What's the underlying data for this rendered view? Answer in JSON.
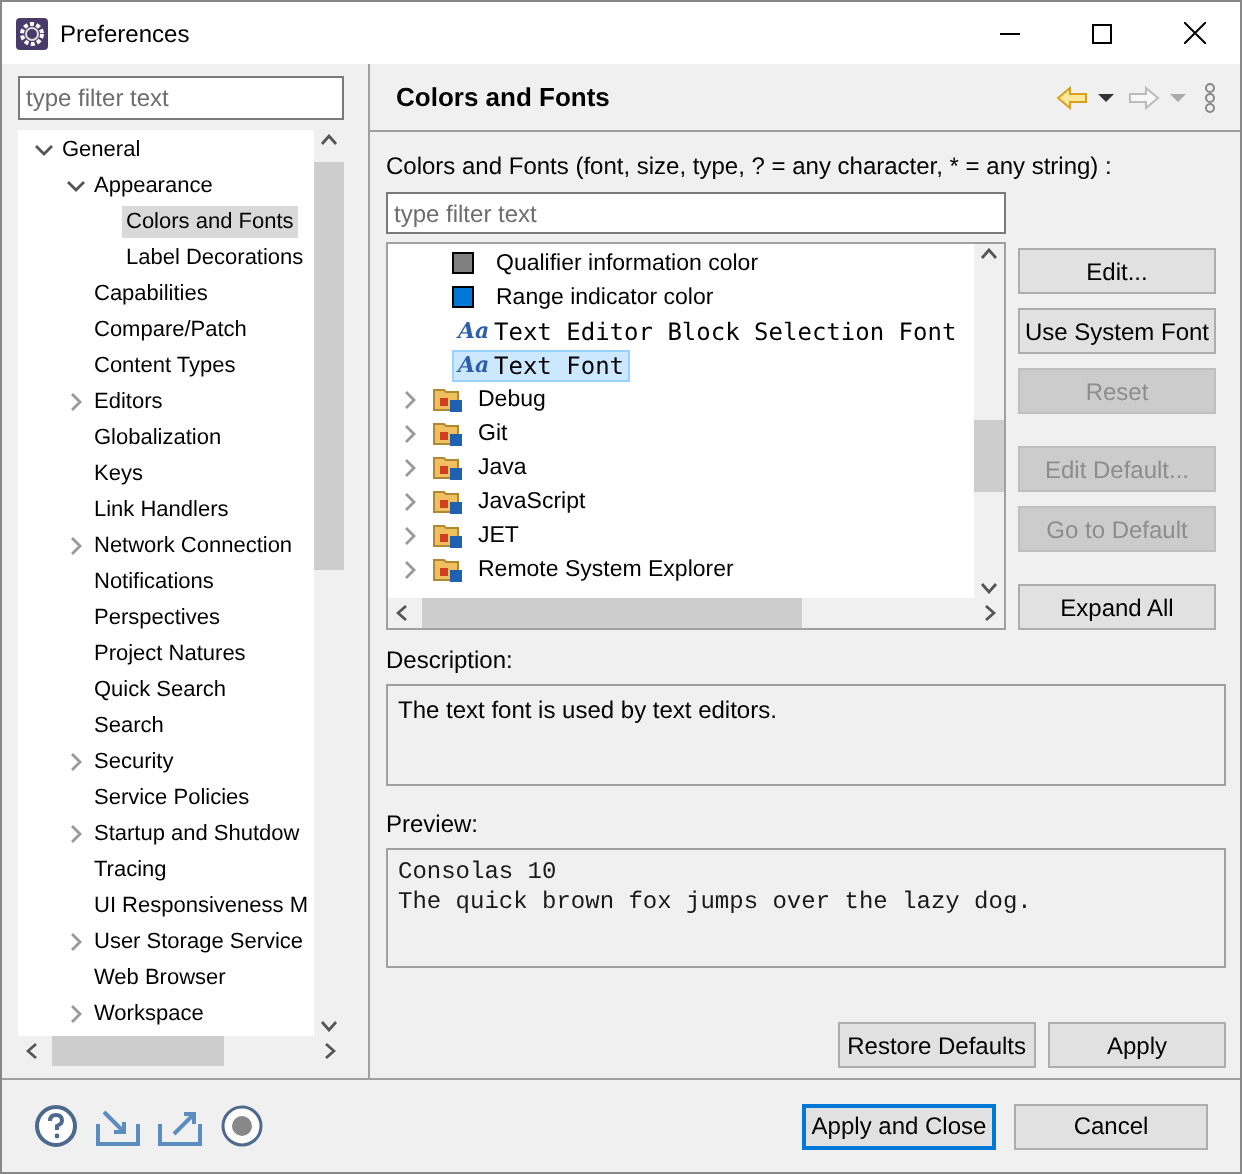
{
  "window": {
    "title": "Preferences"
  },
  "sidebar": {
    "filter": {
      "placeholder": "type filter text"
    },
    "items": [
      {
        "label": "General",
        "kind": "branch",
        "expanded": true,
        "selected": false,
        "children": [
          {
            "label": "Appearance",
            "kind": "branch",
            "expanded": true,
            "selected": false,
            "children": [
              {
                "label": "Colors and Fonts",
                "kind": "leaf",
                "selected": true
              },
              {
                "label": "Label Decorations",
                "kind": "leaf",
                "selected": false
              }
            ]
          },
          {
            "label": "Capabilities",
            "kind": "leaf",
            "selected": false
          },
          {
            "label": "Compare/Patch",
            "kind": "leaf",
            "selected": false
          },
          {
            "label": "Content Types",
            "kind": "leaf",
            "selected": false
          },
          {
            "label": "Editors",
            "kind": "branch",
            "expanded": false,
            "selected": false
          },
          {
            "label": "Globalization",
            "kind": "leaf",
            "selected": false
          },
          {
            "label": "Keys",
            "kind": "leaf",
            "selected": false
          },
          {
            "label": "Link Handlers",
            "kind": "leaf",
            "selected": false
          },
          {
            "label": "Network Connection",
            "kind": "branch",
            "expanded": false,
            "selected": false
          },
          {
            "label": "Notifications",
            "kind": "leaf",
            "selected": false
          },
          {
            "label": "Perspectives",
            "kind": "leaf",
            "selected": false
          },
          {
            "label": "Project Natures",
            "kind": "leaf",
            "selected": false
          },
          {
            "label": "Quick Search",
            "kind": "leaf",
            "selected": false
          },
          {
            "label": "Search",
            "kind": "leaf",
            "selected": false
          },
          {
            "label": "Security",
            "kind": "branch",
            "expanded": false,
            "selected": false
          },
          {
            "label": "Service Policies",
            "kind": "leaf",
            "selected": false
          },
          {
            "label": "Startup and Shutdow",
            "kind": "branch",
            "expanded": false,
            "selected": false
          },
          {
            "label": "Tracing",
            "kind": "leaf",
            "selected": false
          },
          {
            "label": "UI Responsiveness M",
            "kind": "leaf",
            "selected": false
          },
          {
            "label": "User Storage Service",
            "kind": "branch",
            "expanded": false,
            "selected": false
          },
          {
            "label": "Web Browser",
            "kind": "leaf",
            "selected": false
          },
          {
            "label": "Workspace",
            "kind": "branch",
            "expanded": false,
            "selected": false
          }
        ]
      }
    ]
  },
  "page": {
    "title": "Colors and Fonts",
    "filter_label": "Colors and Fonts (font, size, type, ? = any character, * = any string) :",
    "filter": {
      "placeholder": "type filter text"
    },
    "items": [
      {
        "label": "Qualifier information color",
        "kind": "color",
        "color": "#808080",
        "selected": false
      },
      {
        "label": "Range indicator color",
        "kind": "color",
        "color": "#0078d7",
        "selected": false
      },
      {
        "label": "Text Editor Block Selection Font",
        "kind": "font",
        "icon": "Aa",
        "selected": false
      },
      {
        "label": "Text Font",
        "kind": "font",
        "icon": "Aa",
        "selected": true
      },
      {
        "label": "Debug",
        "kind": "category",
        "selected": false
      },
      {
        "label": "Git",
        "kind": "category",
        "selected": false
      },
      {
        "label": "Java",
        "kind": "category",
        "selected": false
      },
      {
        "label": "JavaScript",
        "kind": "category",
        "selected": false
      },
      {
        "label": "JET",
        "kind": "category",
        "selected": false
      },
      {
        "label": "Remote System Explorer",
        "kind": "category",
        "selected": false
      }
    ],
    "buttons": [
      {
        "label": "Edit...",
        "disabled": false
      },
      {
        "label": "Use System Font",
        "disabled": false
      },
      {
        "label": "Reset",
        "disabled": true
      },
      {
        "label": "Edit Default...",
        "disabled": true
      },
      {
        "label": "Go to Default",
        "disabled": true
      },
      {
        "label": "Expand All",
        "disabled": false
      }
    ],
    "description_label": "Description:",
    "description": "The text font is used by text editors.",
    "preview_label": "Preview:",
    "preview": [
      "Consolas 10",
      "The quick brown fox jumps over the lazy dog."
    ],
    "page_buttons": [
      "Restore Defaults",
      "Apply"
    ]
  },
  "footer": {
    "buttons": [
      {
        "label": "Apply and Close",
        "default": true
      },
      {
        "label": "Cancel",
        "default": false
      }
    ]
  }
}
